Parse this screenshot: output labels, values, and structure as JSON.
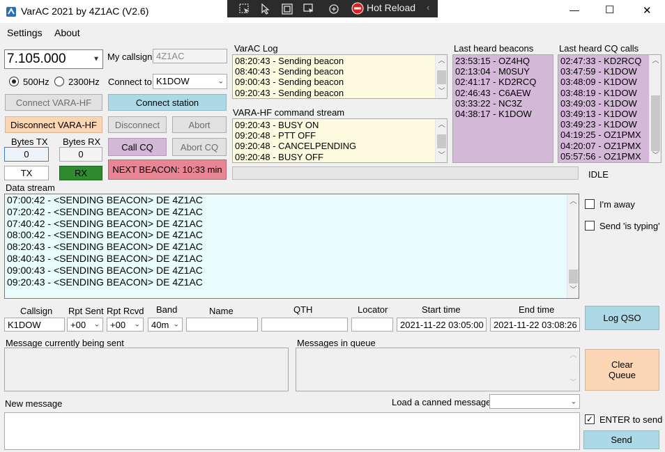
{
  "window": {
    "title": "VarAC 2021 by 4Z1AC (V2.6)",
    "minimize_glyph": "—",
    "maximize_glyph": "☐",
    "close_glyph": "✕"
  },
  "overlay_toolbar": {
    "hot_reload_label": "Hot Reload"
  },
  "menu": {
    "items": [
      "Settings",
      "About"
    ]
  },
  "frequency": {
    "value": "7.105.000"
  },
  "callsign": {
    "label": "My callsign",
    "value": "4Z1AC"
  },
  "bandwidth": {
    "opt1": "500Hz",
    "opt2": "2300Hz",
    "selected": "500Hz"
  },
  "connect_to": {
    "label": "Connect to",
    "value": "K1DOW"
  },
  "buttons": {
    "connect_vara": "Connect VARA-HF",
    "connect_station": "Connect station",
    "disconnect_vara": "Disconnect VARA-HF",
    "disconnect": "Disconnect",
    "abort": "Abort",
    "call_cq": "Call CQ",
    "abort_cq": "Abort CQ",
    "next_beacon": "NEXT BEACON: 10:33 min",
    "log_qso": "Log QSO",
    "clear_queue": "Clear Queue",
    "send": "Send"
  },
  "bytes": {
    "tx_label": "Bytes TX",
    "rx_label": "Bytes RX",
    "tx_value": "0",
    "rx_value": "0"
  },
  "indicators": {
    "tx": "TX",
    "rx": "RX"
  },
  "varac_log": {
    "label": "VarAC Log",
    "lines": [
      "08:20:43 - Sending beacon",
      "08:40:43 - Sending beacon",
      "09:00:43 - Sending beacon",
      "09:20:43 - Sending beacon"
    ]
  },
  "cmd_stream": {
    "label": "VARA-HF command stream",
    "lines": [
      "09:20:43 - BUSY ON",
      "09:20:48 - PTT OFF",
      "09:20:48 - CANCELPENDING",
      "09:20:48 - BUSY OFF"
    ]
  },
  "beacons": {
    "label": "Last heard beacons",
    "lines": [
      "23:53:15 - OZ4HQ",
      "02:13:04 - M0SUY",
      "02:41:17 - KD2RCQ",
      "02:46:43 - C6AEW",
      "03:33:22 - NC3Z",
      "04:38:17 - K1DOW"
    ]
  },
  "cq_calls": {
    "label": "Last heard CQ calls",
    "lines": [
      "02:47:33 - KD2RCQ",
      "03:47:59 - K1DOW",
      "03:48:09 - K1DOW",
      "03:48:19 - K1DOW",
      "03:49:03 - K1DOW",
      "03:49:13 - K1DOW",
      "03:49:23 - K1DOW",
      "04:19:25 - OZ1PMX",
      "04:20:07 - OZ1PMX",
      "05:57:56 - OZ1PMX"
    ]
  },
  "status": {
    "idle": "IDLE"
  },
  "data_stream": {
    "label": "Data stream",
    "lines": [
      "07:00:42 -  <SENDING BEACON> DE 4Z1AC",
      "07:20:42 -  <SENDING BEACON> DE 4Z1AC",
      "07:40:42 -  <SENDING BEACON> DE 4Z1AC",
      "08:00:42 -  <SENDING BEACON> DE 4Z1AC",
      "08:20:43 -  <SENDING BEACON> DE 4Z1AC",
      "08:40:43 -  <SENDING BEACON> DE 4Z1AC",
      "09:00:43 -  <SENDING BEACON> DE 4Z1AC",
      "09:20:43 -  <SENDING BEACON> DE 4Z1AC"
    ]
  },
  "options": {
    "away": "I'm away",
    "typing": "Send 'is typing'",
    "enter_to_send": "ENTER to send"
  },
  "qso": {
    "headers": {
      "callsign": "Callsign",
      "rpt_sent": "Rpt Sent",
      "rpt_rcvd": "Rpt Rcvd",
      "band": "Band",
      "name": "Name",
      "qth": "QTH",
      "locator": "Locator",
      "start": "Start time",
      "end": "End time"
    },
    "callsign": "K1DOW",
    "rpt_sent": "+00",
    "rpt_rcvd": "+00",
    "band": "40m",
    "name": "",
    "qth": "",
    "locator": "",
    "start": "2021-11-22 03:05:00",
    "end": "2021-11-22 03:08:26"
  },
  "messages": {
    "current_label": "Message currently being sent",
    "queue_label": "Messages in queue",
    "new_label": "New message",
    "canned_label": "Load a canned message"
  },
  "colors": {
    "cyan_btn": "#add8e6",
    "orange_btn": "#fbd6b4",
    "purple": "#d4b8d8",
    "red_btn": "#e88696",
    "yellow": "#fcfbe0",
    "data_bg": "#e8fcfc",
    "rx_green": "#2e8b2e"
  }
}
